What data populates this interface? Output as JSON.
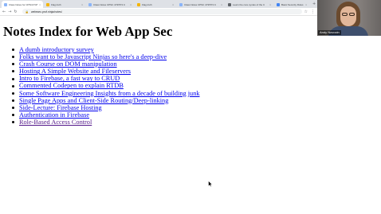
{
  "browser": {
    "tabs": [
      {
        "title": "Class Notes for CPSC473/573 F",
        "icon": "doc-icon",
        "active": true
      },
      {
        "title": "Flag truth",
        "icon": "flag-icon",
        "active": false
      },
      {
        "title": "Class Notes CPSC 473/573 C",
        "icon": "doc-icon",
        "active": false
      },
      {
        "title": "Flag truth",
        "icon": "flag-icon",
        "active": false
      },
      {
        "title": "Class Notes CPSC 473/573 C",
        "icon": "doc-icon",
        "active": false
      },
      {
        "title": "Learn the core syntax of the C",
        "icon": "web-icon",
        "active": false
      },
      {
        "title": "Basic Security Rules",
        "icon": "web-icon",
        "active": false
      }
    ],
    "new_tab_glyph": "+",
    "address": "webrsec.prof.ninja/notes/",
    "toolbar_icons": [
      "back-icon",
      "forward-icon",
      "reload-icon",
      "star-icon",
      "menu-icon"
    ]
  },
  "webcam": {
    "name": "Andy Novocin"
  },
  "page": {
    "title": "Notes Index for Web App Sec",
    "links": [
      {
        "label": "A dumb introductory survey",
        "visited": false
      },
      {
        "label": "Folks want to be Javascript Ninjas so here's a deep-dive",
        "visited": false
      },
      {
        "label": "Crash Course on DOM manipulation",
        "visited": false
      },
      {
        "label": "Hosting A Simple Website and Fileservers",
        "visited": false
      },
      {
        "label": "Intro to Firebase, a fast way to CRUD",
        "visited": false
      },
      {
        "label": "Commented Codepen to explain RTDB",
        "visited": false
      },
      {
        "label": "Some Software Engineering Insights from a decade of building junk",
        "visited": false
      },
      {
        "label": "Single Page Apps and Client-Side Routing/Deep-linking",
        "visited": false
      },
      {
        "label": "Side-Lecture: Firebase Hosting",
        "visited": false
      },
      {
        "label": "Authentication in Firebase",
        "visited": false
      },
      {
        "label": "Role-Based Access Control",
        "visited": true
      }
    ]
  }
}
